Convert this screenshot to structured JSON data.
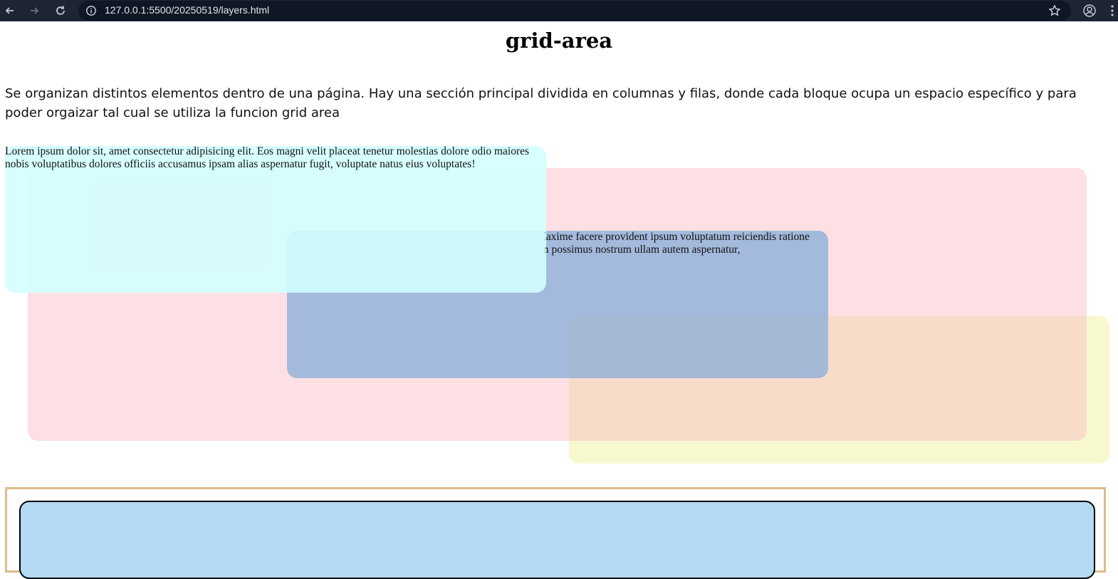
{
  "browser": {
    "url": "127.0.0.1:5500/20250519/layers.html",
    "icons": {
      "back": "arrow-left-icon",
      "forward": "arrow-right-icon",
      "reload": "reload-icon",
      "site_info": "info-icon",
      "bookmark": "star-icon",
      "profile": "profile-icon",
      "menu": "kebab-menu-icon"
    }
  },
  "page": {
    "title": "grid-area",
    "intro": "Se organizan distintos elementos dentro de una página. Hay una sección principal dividida en columnas y filas, donde cada bloque ocupa un espacio específico y para poder orgaizar tal cual se utiliza la funcion grid area",
    "block_text_1": "Lorem ipsum dolor sit, amet consectetur adipisicing elit. Eos magni velit placeat tenetur molestias dolore odio maiores nobis voluptatibus dolores officiis accusamus ipsam alias aspernatur fugit, voluptate natus eius voluptates!",
    "block_text_2": "Lorem ipsum dolor sit amet consectetur adipisicing elit. Maxime facere provident ipsum voluptatum reiciendis ratione quaerat doloribus, veniam dolor expedita modi quod earum possimus nostrum ullam autem aspernatur,"
  },
  "colors": {
    "toolbar": "#1d2533",
    "block_cyan": "#d2ffff",
    "block_pink": "#f8bec4",
    "block_blue": "#8bb0da",
    "block_yellow": "#f3f3b2",
    "container_border": "#dfbb8c",
    "inner_block": "#b3daf2"
  }
}
